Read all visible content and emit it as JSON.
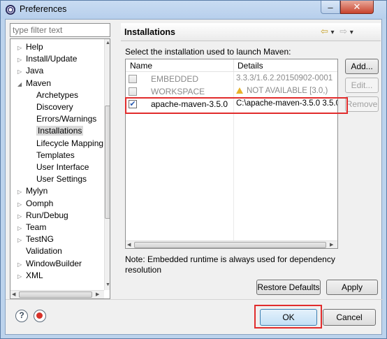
{
  "window": {
    "title": "Preferences",
    "minimize_label": "–",
    "close_label": "✕"
  },
  "filter": {
    "placeholder": "type filter text"
  },
  "tree": {
    "items": [
      {
        "label": "Help",
        "arrow": "▷",
        "indent": 0
      },
      {
        "label": "Install/Update",
        "arrow": "▷",
        "indent": 0
      },
      {
        "label": "Java",
        "arrow": "▷",
        "indent": 0
      },
      {
        "label": "Maven",
        "arrow": "◢",
        "indent": 0
      },
      {
        "label": "Archetypes",
        "arrow": "",
        "indent": 1
      },
      {
        "label": "Discovery",
        "arrow": "",
        "indent": 1
      },
      {
        "label": "Errors/Warnings",
        "arrow": "",
        "indent": 1
      },
      {
        "label": "Installations",
        "arrow": "",
        "indent": 1,
        "selected": true
      },
      {
        "label": "Lifecycle Mapping",
        "arrow": "",
        "indent": 1
      },
      {
        "label": "Templates",
        "arrow": "",
        "indent": 1
      },
      {
        "label": "User Interface",
        "arrow": "",
        "indent": 1
      },
      {
        "label": "User Settings",
        "arrow": "",
        "indent": 1
      },
      {
        "label": "Mylyn",
        "arrow": "▷",
        "indent": 0
      },
      {
        "label": "Oomph",
        "arrow": "▷",
        "indent": 0
      },
      {
        "label": "Run/Debug",
        "arrow": "▷",
        "indent": 0
      },
      {
        "label": "Team",
        "arrow": "▷",
        "indent": 0
      },
      {
        "label": "TestNG",
        "arrow": "▷",
        "indent": 0
      },
      {
        "label": "Validation",
        "arrow": "",
        "indent": 0
      },
      {
        "label": "WindowBuilder",
        "arrow": "▷",
        "indent": 0
      },
      {
        "label": "XML",
        "arrow": "▷",
        "indent": 0
      }
    ]
  },
  "page": {
    "title": "Installations",
    "nav": {
      "back": "⇦",
      "back_menu": "▾",
      "forward": "⇨",
      "forward_menu": "▾"
    },
    "instruction": "Select the installation used to launch Maven:",
    "table": {
      "columns": [
        "Name",
        "Details"
      ],
      "rows": [
        {
          "name": "EMBEDDED",
          "details": "3.3.3/1.6.2.20150902-0001",
          "checked": false,
          "disabled": true,
          "warning": false
        },
        {
          "name": "WORKSPACE",
          "details": "NOT AVAILABLE [3.0,)",
          "checked": false,
          "disabled": true,
          "warning": true
        },
        {
          "name": "apache-maven-3.5.0",
          "details": "C:\\apache-maven-3.5.0 3.5.0",
          "checked": true,
          "disabled": false,
          "warning": false
        }
      ]
    },
    "buttons": {
      "add": "Add...",
      "edit": "Edit...",
      "remove": "Remove"
    },
    "note": "Note: Embedded runtime is always used for dependency resolution",
    "restore_defaults": "Restore Defaults",
    "apply": "Apply"
  },
  "footer": {
    "help_icon": "?",
    "ok": "OK",
    "cancel": "Cancel"
  },
  "colors": {
    "highlight": "#e12c2c",
    "titlebar": "#b7cfec",
    "warning": "#e8b22a"
  },
  "icons": [
    "eclipse-icon",
    "help-icon",
    "record-icon",
    "warning-icon",
    "back-arrow-icon",
    "forward-arrow-icon"
  ]
}
